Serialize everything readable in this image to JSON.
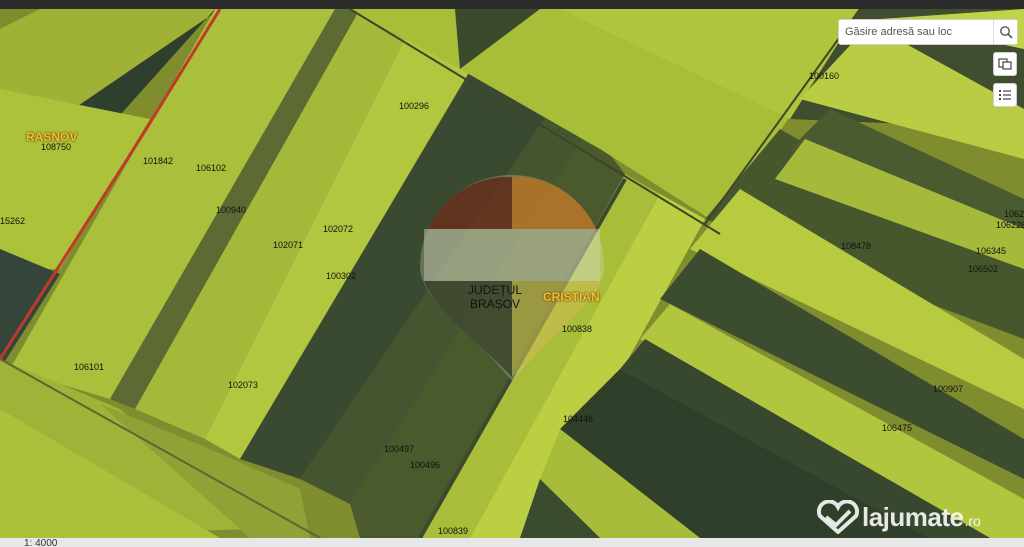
{
  "search": {
    "placeholder": "Găsire adresă sau loc"
  },
  "icons": {
    "search": "search-icon",
    "layers": "layers-icon",
    "legend": "legend-list-icon",
    "watermark": "heart-logo-icon"
  },
  "places": {
    "rasnov": "RASNOV",
    "cristian": "CRISTIAN"
  },
  "county": {
    "line1": "JUDEȚUL",
    "line2": "BRAȘOV"
  },
  "parcels": {
    "p108750": "108750",
    "p101842": "101842",
    "p106102": "106102",
    "p100296": "100296",
    "p100940": "100940",
    "p15262": "15262",
    "p102071": "102071",
    "p102072": "102072",
    "p100302": "100302",
    "p106101": "106101",
    "p102073": "102073",
    "p100838": "100838",
    "p104446": "104446",
    "p100497": "100497",
    "p100496": "100496",
    "p100839": "100839",
    "p100160": "100160",
    "p106223": "10622",
    "p106226": "106226",
    "p108478": "108478",
    "p106345": "106345",
    "p106502": "106502",
    "p100907": "100907",
    "p106475": "106475"
  },
  "scale": {
    "label": "1: 4000"
  },
  "watermark": {
    "text": "lajumate",
    "tld": ".ro"
  },
  "colors": {
    "boundary": "#c0392b",
    "place_label": "#f1c232",
    "field_light": "#b5c93a",
    "field_dark": "#3f4d2b"
  }
}
